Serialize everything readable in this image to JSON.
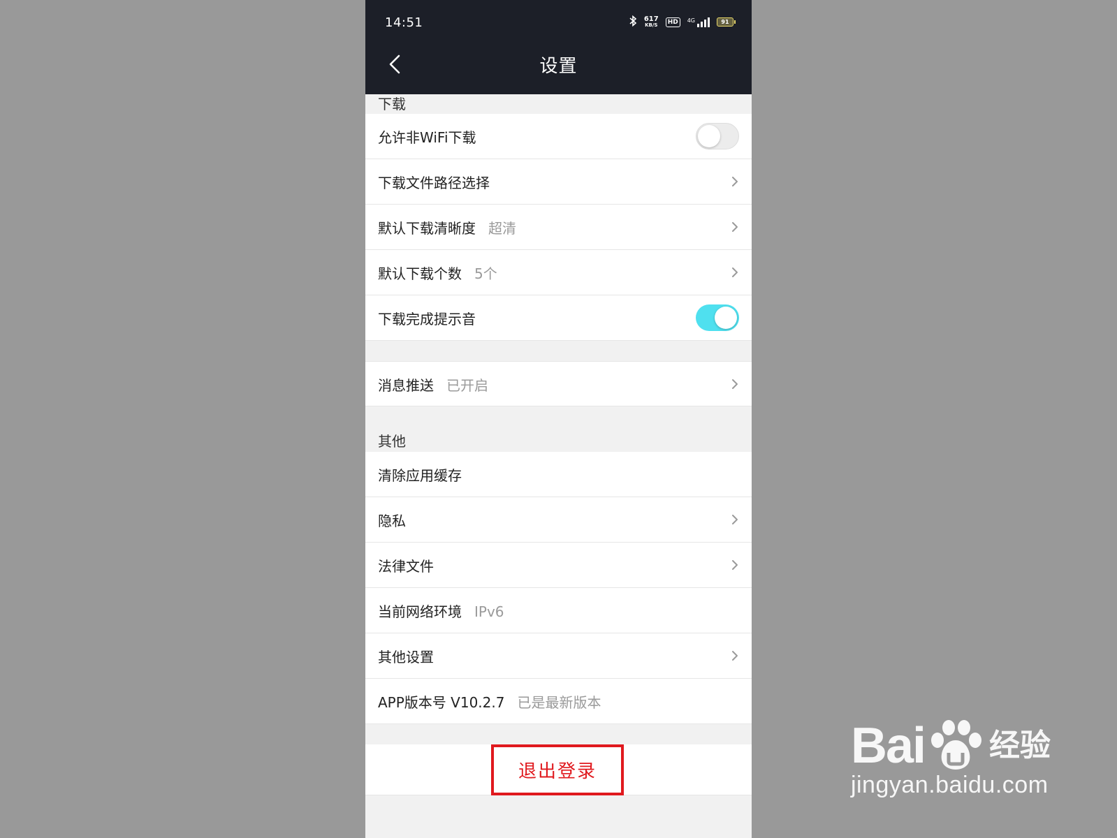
{
  "status_bar": {
    "time": "14:51",
    "speed_value": "617",
    "speed_unit": "KB/S",
    "hd_label": "HD",
    "network_label": "4G",
    "battery_level": "91"
  },
  "header": {
    "title": "设置"
  },
  "sections": {
    "download_header": "下载",
    "other_header": "其他"
  },
  "download_rows": [
    {
      "label": "允许非WiFi下载",
      "toggle_on": false
    },
    {
      "label": "下载文件路径选择"
    },
    {
      "label": "默认下载清晰度",
      "value": "超清"
    },
    {
      "label": "默认下载个数",
      "value": "5个"
    },
    {
      "label": "下载完成提示音",
      "toggle_on": true
    }
  ],
  "push_row": {
    "label": "消息推送",
    "value": "已开启"
  },
  "other_rows": [
    {
      "label": "清除应用缓存"
    },
    {
      "label": "隐私"
    },
    {
      "label": "法律文件"
    },
    {
      "label": "当前网络环境",
      "value": "IPv6"
    },
    {
      "label": "其他设置"
    },
    {
      "label": "APP版本号 V10.2.7",
      "value": "已是最新版本"
    }
  ],
  "logout": {
    "label": "退出登录"
  },
  "watermark": {
    "brand_prefix": "Bai",
    "brand_suffix": "经验",
    "url": "jingyan.baidu.com"
  },
  "colors": {
    "topbar": "#1c1f28",
    "toggle_on": "#4fe0ef",
    "logout_red": "#e0191e",
    "page_bg": "#999999"
  }
}
